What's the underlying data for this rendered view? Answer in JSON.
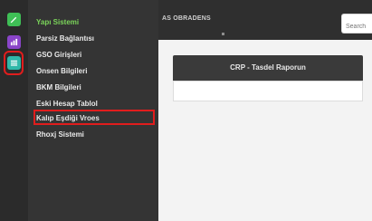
{
  "rail": {
    "items": [
      {
        "icon": "edit-icon",
        "color": "#3fbf56"
      },
      {
        "icon": "chart-icon",
        "color": "#8a45c9"
      },
      {
        "icon": "list-icon",
        "color": "#2fb8a9"
      }
    ]
  },
  "menu": {
    "items": [
      {
        "label": "Yapı Sistemi",
        "active": true
      },
      {
        "label": "Parsiz Bağlantısı"
      },
      {
        "label": "GSO Girişleri"
      },
      {
        "label": "Onsen Bilgileri"
      },
      {
        "label": "BKM Bilgileri"
      },
      {
        "label": "Eski Hesap Tablol"
      },
      {
        "label": "Kalıp Eşdiği Vroes"
      },
      {
        "label": "Rhoxj Sistemi"
      }
    ]
  },
  "topbar": {
    "user": "AS OBRADENS",
    "search_placeholder": "Search"
  },
  "panel": {
    "title": "CRP - Tasdel Raporun"
  },
  "colors": {
    "highlight": "#e11d1d",
    "active_menu": "#7bd55a",
    "rail_bg": "#2b2b2b",
    "menu_bg": "#343434",
    "topbar_bg": "#2f2f2f"
  }
}
